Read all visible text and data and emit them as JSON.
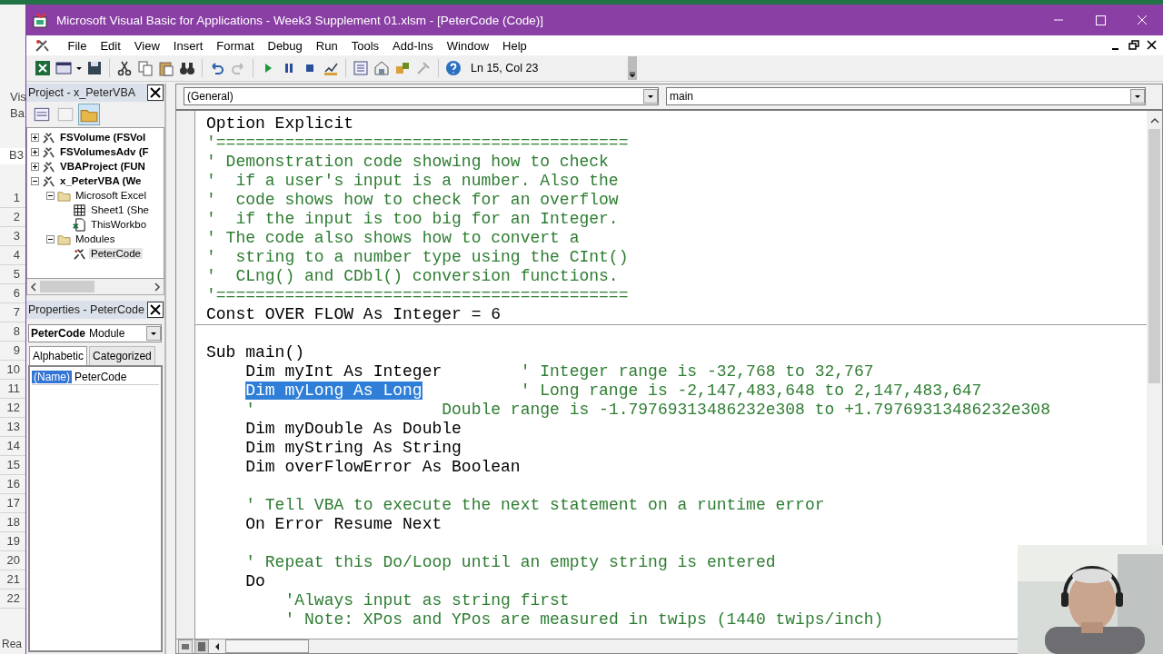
{
  "excel_background": {
    "ribbon_labels": [
      "Vis",
      "Ba"
    ],
    "name_box": "B3",
    "row_numbers": [
      "1",
      "2",
      "3",
      "4",
      "5",
      "6",
      "7",
      "8",
      "9",
      "10",
      "11",
      "12",
      "13",
      "14",
      "15",
      "16",
      "17",
      "18",
      "19",
      "20",
      "21",
      "22"
    ],
    "status": "Rea"
  },
  "window": {
    "title": "Microsoft Visual Basic for Applications - Week3 Supplement 01.xlsm - [PeterCode (Code)]"
  },
  "menu": [
    "File",
    "Edit",
    "View",
    "Insert",
    "Format",
    "Debug",
    "Run",
    "Tools",
    "Add-Ins",
    "Window",
    "Help"
  ],
  "toolbar": {
    "position": "Ln 15, Col 23"
  },
  "project_explorer": {
    "title": "Project - x_PeterVBA",
    "tree": [
      {
        "label": "FSVolume (FSVol",
        "kind": "project",
        "expanded": false,
        "selected": false
      },
      {
        "label": "FSVolumesAdv (F",
        "kind": "project",
        "expanded": false,
        "selected": false
      },
      {
        "label": "VBAProject (FUN",
        "kind": "project",
        "expanded": false,
        "selected": false
      },
      {
        "label": "x_PeterVBA (We",
        "kind": "project",
        "expanded": true,
        "selected": false,
        "children": [
          {
            "label": "Microsoft Excel",
            "kind": "folder",
            "expanded": true,
            "selected": false,
            "children": [
              {
                "label": "Sheet1 (She",
                "kind": "sheet",
                "selected": false
              },
              {
                "label": "ThisWorkbo",
                "kind": "workbook",
                "selected": false
              }
            ]
          },
          {
            "label": "Modules",
            "kind": "folder",
            "expanded": true,
            "selected": false,
            "children": [
              {
                "label": "PeterCode",
                "kind": "module",
                "selected": true
              }
            ]
          }
        ]
      }
    ]
  },
  "properties": {
    "title": "Properties - PeterCode",
    "object_name": "PeterCode",
    "object_type": "Module",
    "tabs": [
      {
        "label": "Alphabetic",
        "selected": true
      },
      {
        "label": "Categorized",
        "selected": false
      }
    ],
    "rows": [
      {
        "name": "(Name)",
        "value": "PeterCode",
        "selected": true
      }
    ]
  },
  "code_window": {
    "object_combo": "(General)",
    "procedure_combo": "main",
    "lines": [
      {
        "kind": "code",
        "code": "Option Explicit",
        "selected": false
      },
      {
        "kind": "comment",
        "comment": "'==========================================",
        "selected": false
      },
      {
        "kind": "comment",
        "comment": "' Demonstration code showing how to check",
        "selected": false
      },
      {
        "kind": "comment",
        "comment": "'  if a user's input is a number. Also the",
        "selected": false
      },
      {
        "kind": "comment",
        "comment": "'  code shows how to check for an overflow",
        "selected": false
      },
      {
        "kind": "comment",
        "comment": "'  if the input is too big for an Integer.",
        "selected": false
      },
      {
        "kind": "comment",
        "comment": "' The code also shows how to convert a",
        "selected": false
      },
      {
        "kind": "comment",
        "comment": "'  string to a number type using the CInt()",
        "selected": false
      },
      {
        "kind": "comment",
        "comment": "'  CLng() and CDbl() conversion functions.",
        "selected": false
      },
      {
        "kind": "comment",
        "comment": "'==========================================",
        "selected": false
      },
      {
        "kind": "code",
        "code": "Const OVER FLOW As Integer = 6",
        "selected": false
      },
      {
        "kind": "separator"
      },
      {
        "kind": "code",
        "code": "Sub main()",
        "selected": false
      },
      {
        "kind": "mixed",
        "code": "    Dim myInt As Integer",
        "comment": "' Integer range is -32,768 to 32,767",
        "selected": false
      },
      {
        "kind": "mixed",
        "code": "    Dim myLong As Long",
        "comment": "' Long range is -2,147,483,648 to 2,147,483,647",
        "selected": true
      },
      {
        "kind": "comment",
        "comment": "    '                   Double range is -1.79769313486232e308 to +1.79769313486232e308",
        "selected": false
      },
      {
        "kind": "code",
        "code": "    Dim myDouble As Double",
        "selected": false
      },
      {
        "kind": "code",
        "code": "    Dim myString As String",
        "selected": false
      },
      {
        "kind": "code",
        "code": "    Dim overFlowError As Boolean",
        "selected": false
      },
      {
        "kind": "blank"
      },
      {
        "kind": "comment",
        "comment": "    ' Tell VBA to execute the next statement on a runtime error",
        "selected": false
      },
      {
        "kind": "code",
        "code": "    On Error Resume Next",
        "selected": false
      },
      {
        "kind": "blank"
      },
      {
        "kind": "comment",
        "comment": "    ' Repeat this Do/Loop until an empty string is entered",
        "selected": false
      },
      {
        "kind": "code",
        "code": "    Do",
        "selected": false
      },
      {
        "kind": "comment",
        "comment": "        'Always input as string first",
        "selected": false
      },
      {
        "kind": "comment",
        "comment": "        ' Note: XPos and YPos are measured in twips (1440 twips/inch)",
        "selected": false
      }
    ]
  }
}
